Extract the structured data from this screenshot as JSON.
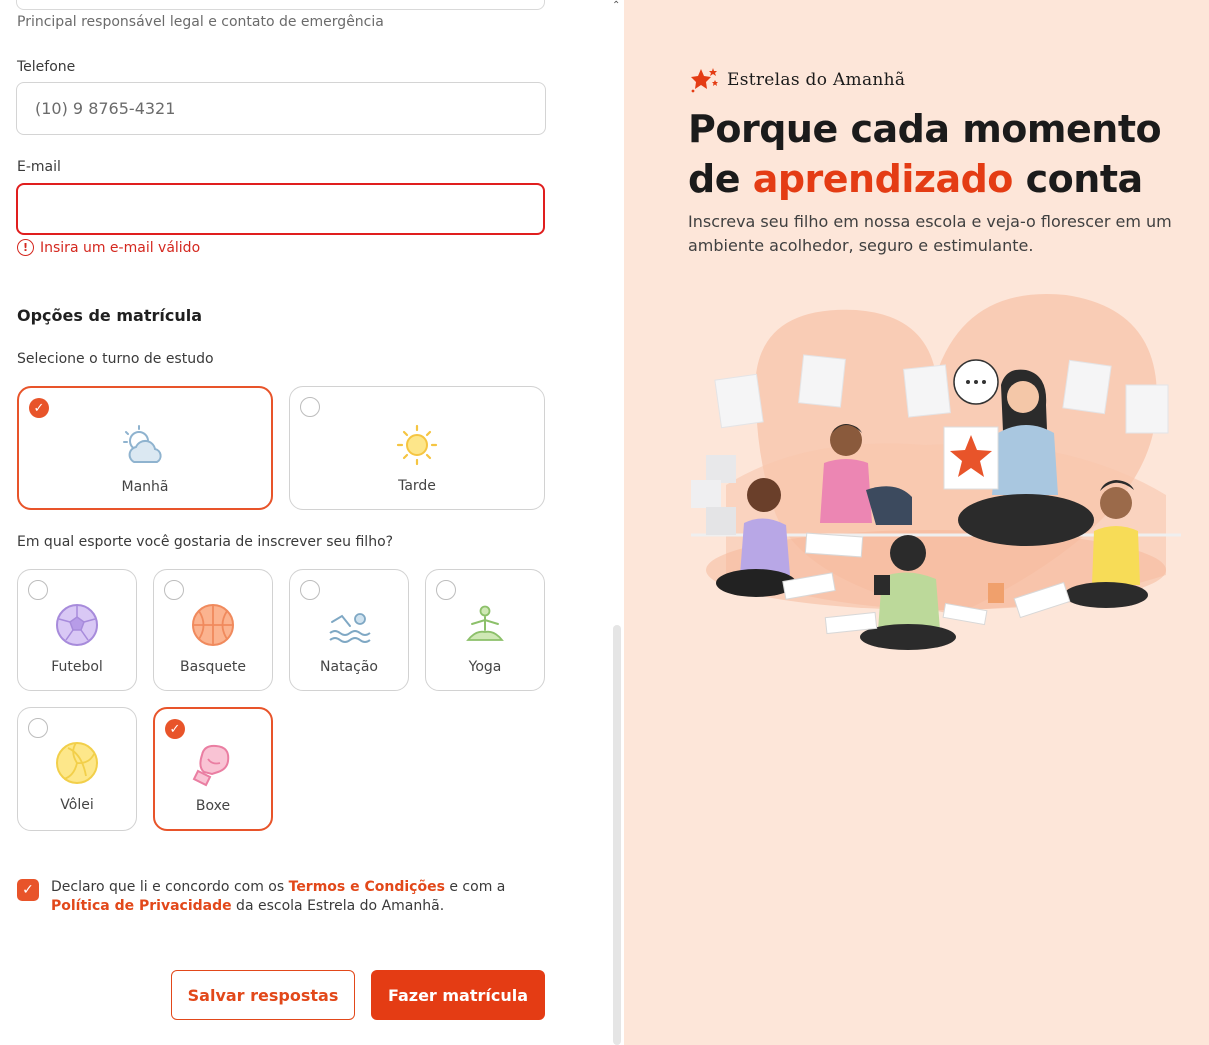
{
  "form": {
    "helper_text": "Principal responsável legal e contato de emergência",
    "phone": {
      "label": "Telefone",
      "placeholder": "(10) 9 8765-4321",
      "value": ""
    },
    "email": {
      "label": "E-mail",
      "value": "",
      "error": "Insira um e-mail válido"
    },
    "enrollment": {
      "title": "Opções de matrícula",
      "shift_question": "Selecione o turno de estudo",
      "shifts": [
        {
          "label": "Manhã",
          "icon": "cloud-sun-icon",
          "selected": true
        },
        {
          "label": "Tarde",
          "icon": "sun-icon",
          "selected": false
        }
      ],
      "sport_question": "Em qual esporte você gostaria de inscrever seu filho?",
      "sports": [
        {
          "label": "Futebol",
          "icon": "soccer-ball-icon",
          "selected": false
        },
        {
          "label": "Basquete",
          "icon": "basketball-icon",
          "selected": false
        },
        {
          "label": "Natação",
          "icon": "swimmer-icon",
          "selected": false
        },
        {
          "label": "Yoga",
          "icon": "yoga-icon",
          "selected": false
        },
        {
          "label": "Vôlei",
          "icon": "volleyball-icon",
          "selected": false
        },
        {
          "label": "Boxe",
          "icon": "boxing-glove-icon",
          "selected": true
        }
      ]
    },
    "terms": {
      "checked": true,
      "part1": "Declaro que li e concordo com os ",
      "link1": "Termos e Condições",
      "part2": " e com a ",
      "link2": "Política de Privacidade",
      "part3": " da escola Estrela do Amanhã."
    },
    "buttons": {
      "save": "Salvar respostas",
      "submit": "Fazer matrícula"
    }
  },
  "hero": {
    "brand": "Estrelas do Amanhã",
    "headline_line1": "Porque cada momento",
    "headline_de": "de ",
    "headline_accent": "aprendizado",
    "headline_end": " conta",
    "subtext": "Inscreva seu filho em nossa escola e veja-o florescer em um ambiente acolhedor, seguro e estimulante."
  },
  "colors": {
    "accent": "#e43c14",
    "error": "#d4281f",
    "hero_bg": "#fde6d9"
  }
}
